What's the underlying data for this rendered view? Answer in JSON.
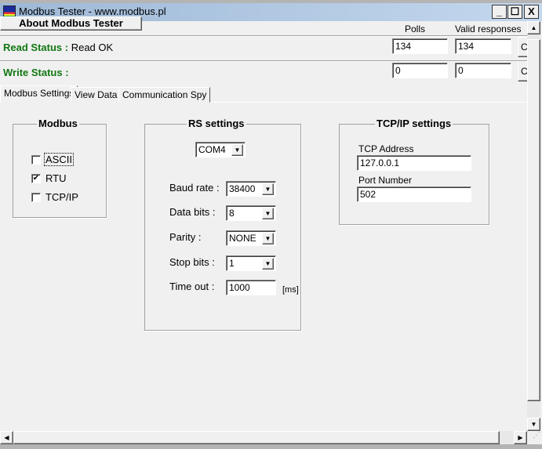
{
  "window": {
    "title": "Modbus Tester - www.modbus.pl",
    "minimize": "_",
    "maximize": "☐",
    "close": "X"
  },
  "toolbar": {
    "about_label": "About Modbus Tester"
  },
  "counters": {
    "polls_label": "Polls",
    "valid_label": "Valid responses",
    "clear_label": "Cl"
  },
  "read": {
    "label": "Read Status :",
    "value": "Read OK",
    "polls": "134",
    "valid": "134"
  },
  "write": {
    "label": "Write Status :",
    "value": "",
    "polls": "0",
    "valid": "0"
  },
  "tabs": [
    {
      "label": "Modbus Settings",
      "active": true
    },
    {
      "label": "View Data"
    },
    {
      "label": "Communication Spy"
    }
  ],
  "modbus": {
    "title": "Modbus",
    "options": [
      {
        "label": "ASCII",
        "checked": false
      },
      {
        "label": "RTU",
        "checked": true
      },
      {
        "label": "TCP/IP",
        "checked": false
      }
    ]
  },
  "rs": {
    "title": "RS settings",
    "port": "COM4",
    "baud_label": "Baud rate :",
    "baud": "38400",
    "data_label": "Data bits :",
    "data": "8",
    "parity_label": "Parity :",
    "parity": "NONE",
    "stop_label": "Stop bits :",
    "stop": "1",
    "timeout_label": "Time out :",
    "timeout": "1000",
    "timeout_unit": "[ms]"
  },
  "tcp": {
    "title": "TCP/IP settings",
    "address_label": "TCP Address",
    "address": "127.0.0.1",
    "port_label": "Port Number",
    "port": "502"
  }
}
